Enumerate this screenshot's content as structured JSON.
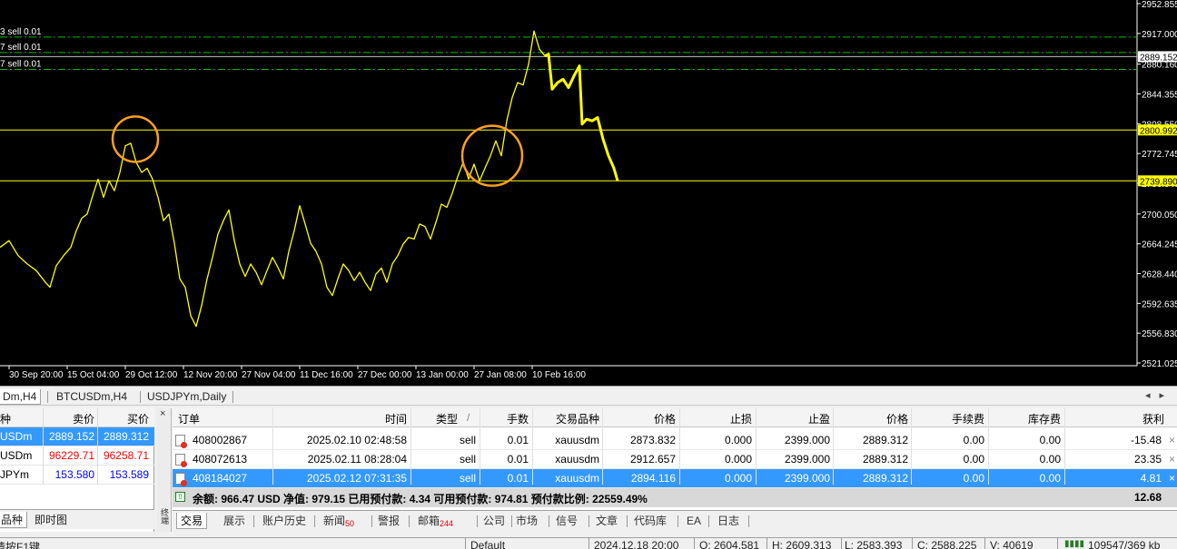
{
  "chart_tabs": [
    {
      "label": "Dm,H4",
      "active": true
    },
    {
      "label": "BTCUSDm,H4",
      "active": false
    },
    {
      "label": "USDJPYm,Daily",
      "active": false
    }
  ],
  "chart_data": {
    "type": "line",
    "symbol": "xauusdm",
    "price_axis_ticks": [
      "2952.855",
      "2917.000",
      "2880.160",
      "2844.355",
      "2808.550",
      "2772.745",
      "2736.940",
      "2700.050",
      "2664.245",
      "2628.440",
      "2592.635",
      "2556.830",
      "2521.025"
    ],
    "price_tags": [
      {
        "value": "2889.152",
        "color": "#ffffff",
        "role": "bid"
      },
      {
        "value": "2800.992",
        "color": "#ffff00",
        "role": "horizontal-line"
      },
      {
        "value": "2739.890",
        "color": "#ffff00",
        "role": "horizontal-line"
      }
    ],
    "time_axis_ticks": [
      "30 Sep 20:00",
      "15 Oct 04:00",
      "29 Oct 12:00",
      "12 Nov 20:00",
      "27 Nov 04:00",
      "11 Dec 16:00",
      "27 Dec 00:00",
      "13 Jan 00:00",
      "27 Jan 08:00",
      "10 Feb 16:00"
    ],
    "order_lines": [
      {
        "label": "3 sell 0.01",
        "price": 2912.657
      },
      {
        "label": "7 sell 0.01",
        "price": 2894.116
      },
      {
        "label": "7 sell 0.01",
        "price": 2873.832
      }
    ],
    "series": [
      {
        "color": "#ffff00",
        "points": [
          [
            0,
            2660
          ],
          [
            10,
            2668
          ],
          [
            20,
            2650
          ],
          [
            30,
            2640
          ],
          [
            40,
            2632
          ],
          [
            50,
            2618
          ],
          [
            55,
            2612
          ],
          [
            62,
            2638
          ],
          [
            70,
            2650
          ],
          [
            78,
            2660
          ],
          [
            84,
            2680
          ],
          [
            90,
            2695
          ],
          [
            96,
            2700
          ],
          [
            102,
            2722
          ],
          [
            108,
            2742
          ],
          [
            114,
            2720
          ],
          [
            120,
            2740
          ],
          [
            126,
            2728
          ],
          [
            132,
            2750
          ],
          [
            138,
            2782
          ],
          [
            144,
            2785
          ],
          [
            150,
            2762
          ],
          [
            156,
            2750
          ],
          [
            162,
            2755
          ],
          [
            168,
            2742
          ],
          [
            174,
            2720
          ],
          [
            180,
            2692
          ],
          [
            186,
            2700
          ],
          [
            192,
            2665
          ],
          [
            198,
            2622
          ],
          [
            204,
            2612
          ],
          [
            210,
            2578
          ],
          [
            216,
            2565
          ],
          [
            222,
            2590
          ],
          [
            228,
            2622
          ],
          [
            234,
            2648
          ],
          [
            240,
            2676
          ],
          [
            246,
            2692
          ],
          [
            252,
            2705
          ],
          [
            258,
            2668
          ],
          [
            264,
            2640
          ],
          [
            270,
            2625
          ],
          [
            276,
            2640
          ],
          [
            282,
            2630
          ],
          [
            288,
            2615
          ],
          [
            294,
            2632
          ],
          [
            300,
            2648
          ],
          [
            306,
            2636
          ],
          [
            312,
            2622
          ],
          [
            318,
            2655
          ],
          [
            324,
            2680
          ],
          [
            330,
            2710
          ],
          [
            336,
            2688
          ],
          [
            342,
            2665
          ],
          [
            348,
            2655
          ],
          [
            354,
            2640
          ],
          [
            360,
            2612
          ],
          [
            366,
            2602
          ],
          [
            372,
            2622
          ],
          [
            378,
            2640
          ],
          [
            384,
            2632
          ],
          [
            390,
            2620
          ],
          [
            396,
            2630
          ],
          [
            402,
            2618
          ],
          [
            408,
            2608
          ],
          [
            414,
            2628
          ],
          [
            420,
            2635
          ],
          [
            426,
            2618
          ],
          [
            432,
            2640
          ],
          [
            438,
            2650
          ],
          [
            444,
            2664
          ],
          [
            450,
            2672
          ],
          [
            456,
            2670
          ],
          [
            462,
            2688
          ],
          [
            468,
            2685
          ],
          [
            474,
            2670
          ],
          [
            480,
            2690
          ],
          [
            486,
            2712
          ],
          [
            492,
            2708
          ],
          [
            498,
            2725
          ],
          [
            504,
            2745
          ],
          [
            510,
            2762
          ],
          [
            516,
            2742
          ],
          [
            522,
            2760
          ],
          [
            528,
            2740
          ],
          [
            534,
            2755
          ],
          [
            540,
            2770
          ],
          [
            546,
            2788
          ],
          [
            552,
            2770
          ],
          [
            558,
            2812
          ],
          [
            564,
            2840
          ],
          [
            570,
            2858
          ],
          [
            576,
            2855
          ],
          [
            582,
            2880
          ],
          [
            588,
            2920
          ],
          [
            594,
            2898
          ],
          [
            600,
            2890
          ]
        ]
      },
      {
        "color": "#ffff00",
        "points": [
          [
            600,
            2890
          ],
          [
            604,
            2892
          ],
          [
            608,
            2850
          ],
          [
            614,
            2858
          ],
          [
            620,
            2862
          ],
          [
            626,
            2852
          ],
          [
            632,
            2866
          ],
          [
            638,
            2878
          ],
          [
            641,
            2808
          ],
          [
            646,
            2814
          ],
          [
            652,
            2812
          ],
          [
            658,
            2816
          ],
          [
            664,
            2790
          ],
          [
            670,
            2770
          ],
          [
            676,
            2755
          ],
          [
            680,
            2740
          ]
        ]
      }
    ]
  },
  "market_watch": {
    "headers": [
      "种",
      "卖价",
      "买价"
    ],
    "rows": [
      {
        "symbol": "USDm",
        "bid": "2889.152",
        "ask": "2889.312",
        "selected": true
      },
      {
        "symbol": "USDm",
        "bid": "96229.71",
        "ask": "96258.71",
        "selected": false
      },
      {
        "symbol": "JPYm",
        "bid": "153.580",
        "ask": "153.589",
        "selected": false
      }
    ],
    "tabs": [
      "品种",
      "即时图"
    ]
  },
  "terminal": {
    "close_label": "×",
    "side_label": "终端",
    "headers": [
      "订单",
      "时间",
      "类型",
      "手数",
      "交易品种",
      "价格",
      "止损",
      "止盈",
      "价格",
      "手续费",
      "库存费",
      "获利"
    ],
    "sort_glyph": "/",
    "orders": [
      {
        "order": "408002867",
        "time": "2025.02.10 02:48:58",
        "type": "sell",
        "lots": "0.01",
        "symbol": "xauusdm",
        "open_price": "2873.832",
        "sl": "0.000",
        "tp": "2399.000",
        "price": "2889.312",
        "commission": "0.00",
        "swap": "0.00",
        "profit": "-15.48",
        "selected": false
      },
      {
        "order": "408072613",
        "time": "2025.02.11 08:28:04",
        "type": "sell",
        "lots": "0.01",
        "symbol": "xauusdm",
        "open_price": "2912.657",
        "sl": "0.000",
        "tp": "2399.000",
        "price": "2889.312",
        "commission": "0.00",
        "swap": "0.00",
        "profit": "23.35",
        "selected": false
      },
      {
        "order": "408184027",
        "time": "2025.02.12 07:31:35",
        "type": "sell",
        "lots": "0.01",
        "symbol": "xauusdm",
        "open_price": "2894.116",
        "sl": "0.000",
        "tp": "2399.000",
        "price": "2889.312",
        "commission": "0.00",
        "swap": "0.00",
        "profit": "4.81",
        "selected": true
      }
    ],
    "balance_line": "余额: 966.47 USD  净值: 979.15  已用预付款: 4.34  可用预付款: 974.81  预付款比例: 22559.49%",
    "total_profit": "12.68",
    "tabs": [
      {
        "label": "交易",
        "badge": "",
        "active": true
      },
      {
        "label": "展示",
        "badge": "",
        "active": false
      },
      {
        "label": "账户历史",
        "badge": "",
        "active": false
      },
      {
        "label": "新闻",
        "badge": "50",
        "active": false
      },
      {
        "label": "警报",
        "badge": "",
        "active": false
      },
      {
        "label": "邮箱",
        "badge": "244",
        "active": false
      },
      {
        "label": "公司",
        "badge": "",
        "active": false
      },
      {
        "label": "市场",
        "badge": "",
        "active": false
      },
      {
        "label": "信号",
        "badge": "",
        "active": false
      },
      {
        "label": "文章",
        "badge": "",
        "active": false
      },
      {
        "label": "代码库",
        "badge": "",
        "active": false
      },
      {
        "label": "EA",
        "badge": "",
        "active": false
      },
      {
        "label": "日志",
        "badge": "",
        "active": false
      }
    ]
  },
  "status_bar": {
    "help": "请按F1键",
    "profile": "Default",
    "datetime": "2024.12.18 20:00",
    "open": "O: 2604.581",
    "high": "H: 2609.313",
    "low": "L: 2583.393",
    "close": "C: 2588.225",
    "volume": "V: 40619",
    "traffic": "109547/369 kb"
  }
}
